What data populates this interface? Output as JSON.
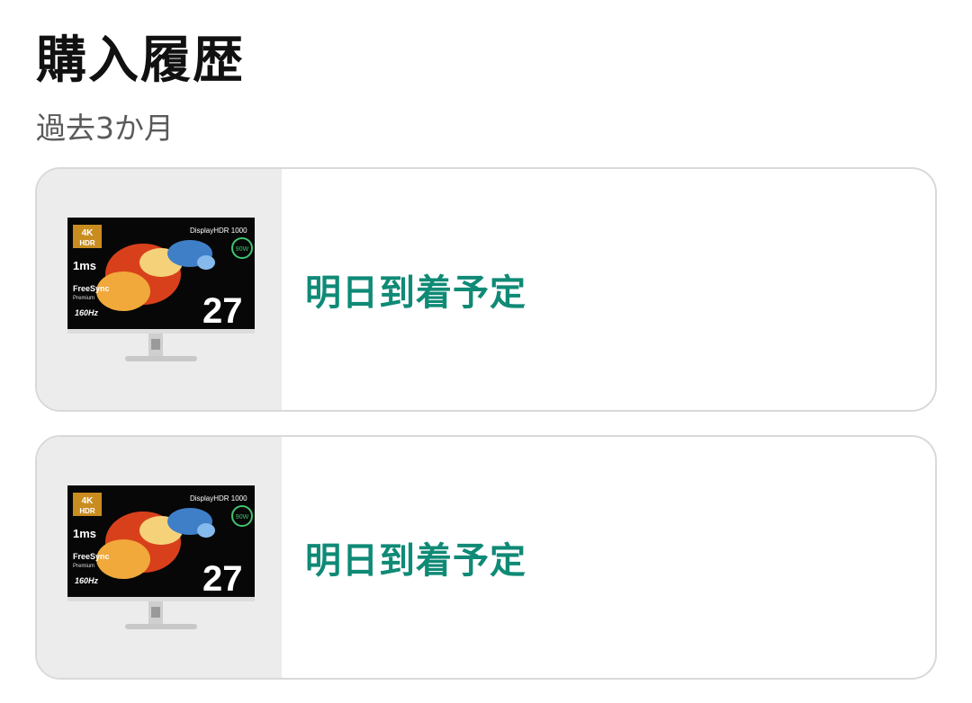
{
  "header": {
    "title": "購入履歴",
    "period": "過去3か月"
  },
  "orders": [
    {
      "status": "明日到着予定",
      "product_image": {
        "badge_4k": "4K",
        "badge_hdr": "HDR",
        "display_hdr": "DisplayHDR 1000",
        "response": "1ms",
        "freesync": "FreeSync",
        "freesync_tier": "Premium",
        "refresh": "160Hz",
        "size": "27",
        "usb_power": "90W"
      }
    },
    {
      "status": "明日到着予定",
      "product_image": {
        "badge_4k": "4K",
        "badge_hdr": "HDR",
        "display_hdr": "DisplayHDR 1000",
        "response": "1ms",
        "freesync": "FreeSync",
        "freesync_tier": "Premium",
        "refresh": "160Hz",
        "size": "27",
        "usb_power": "90W"
      }
    }
  ],
  "colors": {
    "accent": "#0f8a76",
    "card_border": "#d9d9d9",
    "thumb_bg": "#ececec"
  }
}
